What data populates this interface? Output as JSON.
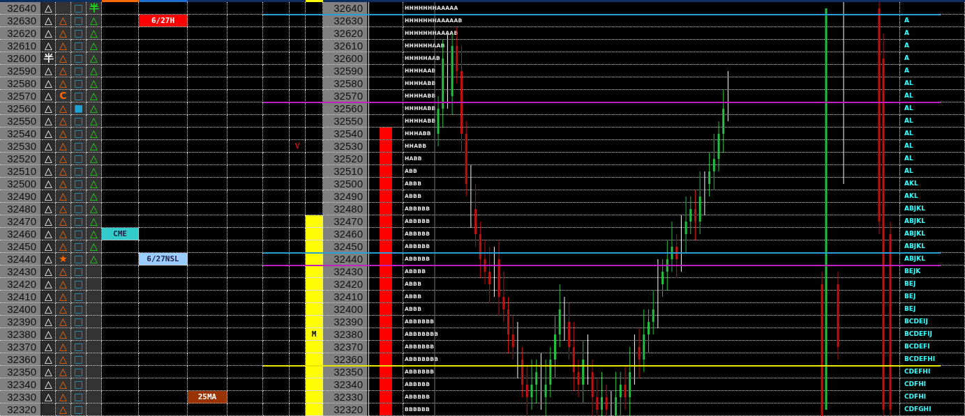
{
  "rows": [
    {
      "price": "32640",
      "c1": "△",
      "c3": "□",
      "c4": "半",
      "tpo": "HHHHHHHAAAAA",
      "price_2": "32640",
      "marker_bar": false,
      "volume_bar": false
    },
    {
      "price": "32630",
      "c1": "△",
      "c2": "△",
      "c3": "□",
      "c4": "△",
      "col_6": {
        "text": "6/27H",
        "color": "#ff0000"
      },
      "tpo": "HHHHHHHAAAAAB",
      "price_2": "32630",
      "letters": "A",
      "line": {
        "color": "#2a9fd6"
      },
      "marker_bar": false,
      "volume_bar": false
    },
    {
      "price": "32620",
      "c1": "△",
      "c2": "△",
      "c3": "□",
      "c4": "△",
      "tpo": "HHHHHHHAAAAB",
      "price_2": "32620",
      "letters": "A",
      "marker_bar": false,
      "volume_bar": false
    },
    {
      "price": "32610",
      "c1": "△",
      "c2": "△",
      "c3": "□",
      "c4": "△",
      "tpo": "HHHHHHAAB",
      "price_2": "32610",
      "letters": "A",
      "marker_bar": false,
      "volume_bar": false
    },
    {
      "price": "32600",
      "c1": "半",
      "c2": "△",
      "c3": "□",
      "c4": "△",
      "tpo": "HHHHHAAB",
      "price_2": "32600",
      "letters": "A",
      "marker_bar": false,
      "volume_bar": false
    },
    {
      "price": "32590",
      "c1": "△",
      "c2": "△",
      "c3": "□",
      "c4": "△",
      "tpo": "HHHHAAB",
      "price_2": "32590",
      "letters": "A",
      "marker_bar": false,
      "volume_bar": false
    },
    {
      "price": "32580",
      "c1": "△",
      "c2": "△",
      "c3": "□",
      "c4": "△",
      "tpo": "HHHHABB",
      "price_2": "32580",
      "letters": "AL",
      "marker_bar": false,
      "volume_bar": false
    },
    {
      "price": "32570",
      "c1": "△",
      "c2": "C",
      "c3": "□",
      "c4": "△",
      "tpo": "HHHHABB",
      "price_2": "32570",
      "letters": "AL",
      "marker_bar": false,
      "volume_bar": false
    },
    {
      "price": "32560",
      "c1": "△",
      "c2": "△",
      "c3": "■",
      "c4": "△",
      "tpo": "HHHHABB",
      "price_2": "32560",
      "letters": "AL",
      "line": {
        "color": "#c020c0"
      },
      "marker_bar": false,
      "volume_bar": false
    },
    {
      "price": "32550",
      "c1": "△",
      "c2": "△",
      "c3": "□",
      "c4": "△",
      "tpo": "HHHHABB",
      "price_2": "32550",
      "letters": "AL",
      "marker_bar": false,
      "volume_bar": false
    },
    {
      "price": "32540",
      "c1": "△",
      "c2": "△",
      "c3": "□",
      "c4": "△",
      "tpo": "HHHABB",
      "price_2": "32540",
      "letters": "AL",
      "marker_bar": false,
      "volume_bar": true
    },
    {
      "price": "32530",
      "c1": "△",
      "c2": "△",
      "c3": "□",
      "c4": "△",
      "col_9": "V",
      "tpo": "HHABB",
      "price_2": "32530",
      "letters": "AL",
      "marker_bar": false,
      "volume_bar": true
    },
    {
      "price": "32520",
      "c1": "△",
      "c2": "△",
      "c3": "□",
      "c4": "△",
      "tpo": "HABB",
      "price_2": "32520",
      "letters": "AL",
      "marker_bar": false,
      "volume_bar": true
    },
    {
      "price": "32510",
      "c1": "△",
      "c2": "△",
      "c3": "□",
      "c4": "△",
      "tpo": "ABB",
      "price_2": "32510",
      "letters": "AL",
      "marker_bar": false,
      "volume_bar": true
    },
    {
      "price": "32500",
      "c1": "△",
      "c2": "△",
      "c3": "□",
      "c4": "△",
      "tpo": "ABBB",
      "price_2": "32500",
      "letters": "AKL",
      "marker_bar": false,
      "volume_bar": true
    },
    {
      "price": "32490",
      "c1": "△",
      "c2": "△",
      "c3": "□",
      "c4": "△",
      "tpo": "ABBB",
      "price_2": "32490",
      "letters": "AKL",
      "marker_bar": false,
      "volume_bar": true
    },
    {
      "price": "32480",
      "c1": "△",
      "c2": "△",
      "c3": "□",
      "c4": "△",
      "tpo": "ABBBBB",
      "price_2": "32480",
      "letters": "ABJKL",
      "marker_bar": false,
      "volume_bar": true
    },
    {
      "price": "32470",
      "c1": "△",
      "c2": "△",
      "c3": "□",
      "c4": "△",
      "tpo": "ABBBBB",
      "price_2": "32470",
      "letters": "ABJKL",
      "marker_bar": true,
      "volume_bar": true
    },
    {
      "price": "32460",
      "c1": "△",
      "c2": "△",
      "c3": "□",
      "c4": "△",
      "col_5": {
        "text": "CME",
        "color": "#33cccc"
      },
      "tpo": "ABBBBB",
      "price_2": "32460",
      "letters": "ABJKL",
      "marker_bar": true,
      "volume_bar": true
    },
    {
      "price": "32450",
      "c1": "△",
      "c2": "△",
      "c3": "□",
      "c4": "△",
      "tpo": "ABBBBB",
      "price_2": "32450",
      "letters": "ABJKL",
      "marker_bar": true,
      "volume_bar": true
    },
    {
      "price": "32440",
      "c1": "△",
      "c2": "★",
      "c3": "□",
      "c4": "△",
      "col_6": {
        "text": "6/27NSL",
        "color": "#99ccff"
      },
      "tpo": "ABBBBB",
      "price_2": "32440",
      "letters": "ABJKL",
      "line": {
        "color": "#2a9fd6"
      },
      "marker_bar": true,
      "volume_bar": true
    },
    {
      "price": "32430",
      "c1": "△",
      "c2": "△",
      "c3": "□",
      "tpo": "ABBBB",
      "price_2": "32430",
      "letters": "BEJK",
      "line": {
        "color": "#c020c0"
      },
      "marker_bar": true,
      "volume_bar": true
    },
    {
      "price": "32420",
      "c1": "△",
      "c2": "△",
      "c3": "□",
      "tpo": "ABBB",
      "price_2": "32420",
      "letters": "BEJ",
      "marker_bar": true,
      "volume_bar": true
    },
    {
      "price": "32410",
      "c1": "△",
      "c2": "△",
      "c3": "□",
      "tpo": "ABBB",
      "price_2": "32410",
      "letters": "BEJ",
      "marker_bar": true,
      "volume_bar": true
    },
    {
      "price": "32400",
      "c1": "△",
      "c2": "△",
      "c3": "□",
      "tpo": "ABBB",
      "price_2": "32400",
      "letters": "BEJ",
      "marker_bar": true,
      "volume_bar": true
    },
    {
      "price": "32390",
      "c1": "△",
      "c2": "△",
      "c3": "□",
      "tpo": "ABBBBBB",
      "price_2": "32390",
      "letters": "BCDEIJ",
      "marker_bar": true,
      "volume_bar": true
    },
    {
      "price": "32380",
      "c1": "△",
      "c2": "△",
      "c3": "□",
      "col_10": "M",
      "tpo": "ABBBBBBB",
      "price_2": "32380",
      "letters": "BCDEFIJ",
      "marker_bar": true,
      "volume_bar": true
    },
    {
      "price": "32370",
      "c1": "△",
      "c2": "△",
      "c3": "□",
      "tpo": "ABBBBBB",
      "price_2": "32370",
      "letters": "BCDEFI",
      "marker_bar": true,
      "volume_bar": true
    },
    {
      "price": "32360",
      "c1": "△",
      "c2": "△",
      "c3": "□",
      "tpo": "ABBBBBBB",
      "price_2": "32360",
      "letters": "BCDEFHI",
      "marker_bar": true,
      "volume_bar": true
    },
    {
      "price": "32350",
      "c1": "△",
      "c2": "△",
      "c3": "□",
      "tpo": "ABBBBBB",
      "price_2": "32350",
      "letters": "CDEFHI",
      "line": {
        "color": "#e8e800"
      },
      "marker_bar": true,
      "volume_bar": true
    },
    {
      "price": "32340",
      "c1": "△",
      "c2": "△",
      "c3": "□",
      "tpo": "ABBBBB",
      "price_2": "32340",
      "letters": "CDFHI",
      "marker_bar": true,
      "volume_bar": true
    },
    {
      "price": "32330",
      "c1": "△",
      "c2": "△",
      "c3": "□",
      "col_7": {
        "text": "25MA",
        "color": "#993300"
      },
      "tpo": "ABBBBB",
      "price_2": "32330",
      "letters": "CDFHI",
      "marker_bar": true,
      "volume_bar": true
    },
    {
      "price": "32320",
      "c2": "△",
      "c3": "□",
      "tpo": "BBBBBB",
      "price_2": "32320",
      "letters": "CDFGHI",
      "marker_bar": true,
      "volume_bar": true
    }
  ]
}
